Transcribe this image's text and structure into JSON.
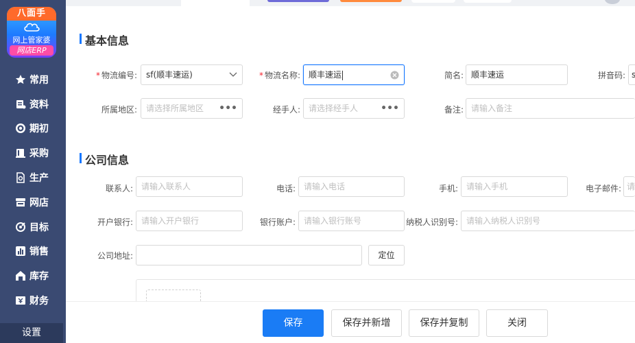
{
  "logo": {
    "brand": "八面手",
    "subtitle": "网上管家婆",
    "product": "网店ERP"
  },
  "nav": {
    "items": [
      {
        "label": "常用",
        "icon": "star-icon"
      },
      {
        "label": "资料",
        "icon": "document-icon"
      },
      {
        "label": "期初",
        "icon": "target-icon"
      },
      {
        "label": "采购",
        "icon": "book-icon"
      },
      {
        "label": "生产",
        "icon": "factory-icon"
      },
      {
        "label": "网店",
        "icon": "store-icon"
      },
      {
        "label": "目标",
        "icon": "aim-icon"
      },
      {
        "label": "销售",
        "icon": "chart-icon"
      },
      {
        "label": "库存",
        "icon": "warehouse-icon"
      },
      {
        "label": "财务",
        "icon": "finance-icon"
      }
    ],
    "settings_label": "设置"
  },
  "basic": {
    "title": "基本信息",
    "code_label": "物流编号:",
    "code_value": "sf(顺丰速运)",
    "name_label": "物流名称:",
    "name_value": "顺丰速运",
    "short_label": "简名:",
    "short_value": "顺丰速运",
    "pinyin_label": "拼音码:",
    "pinyin_value": "s",
    "region_label": "所属地区:",
    "region_placeholder": "请选择所属地区",
    "handler_label": "经手人:",
    "handler_placeholder": "请选择经手人",
    "remark_label": "备注:",
    "remark_placeholder": "请输入备注"
  },
  "company": {
    "title": "公司信息",
    "contact_label": "联系人:",
    "contact_placeholder": "请输入联系人",
    "phone_label": "电话:",
    "phone_placeholder": "请输入电话",
    "mobile_label": "手机:",
    "mobile_placeholder": "请输入手机",
    "email_label": "电子邮件:",
    "email_placeholder": "请",
    "bank_label": "开户银行:",
    "bank_placeholder": "请输入开户银行",
    "account_label": "银行账户:",
    "account_placeholder": "请输入银行账号",
    "tax_label": "纳税人识别号:",
    "tax_placeholder": "请输入纳税人识别号",
    "address_label": "公司地址:",
    "address_value": "",
    "locate_label": "定位"
  },
  "footer": {
    "save": "保存",
    "save_new": "保存并新增",
    "save_copy": "保存并复制",
    "close": "关闭"
  },
  "colors": {
    "sidebar": "#3a4a72",
    "primary": "#1a7cf5",
    "required": "#f5222d"
  }
}
